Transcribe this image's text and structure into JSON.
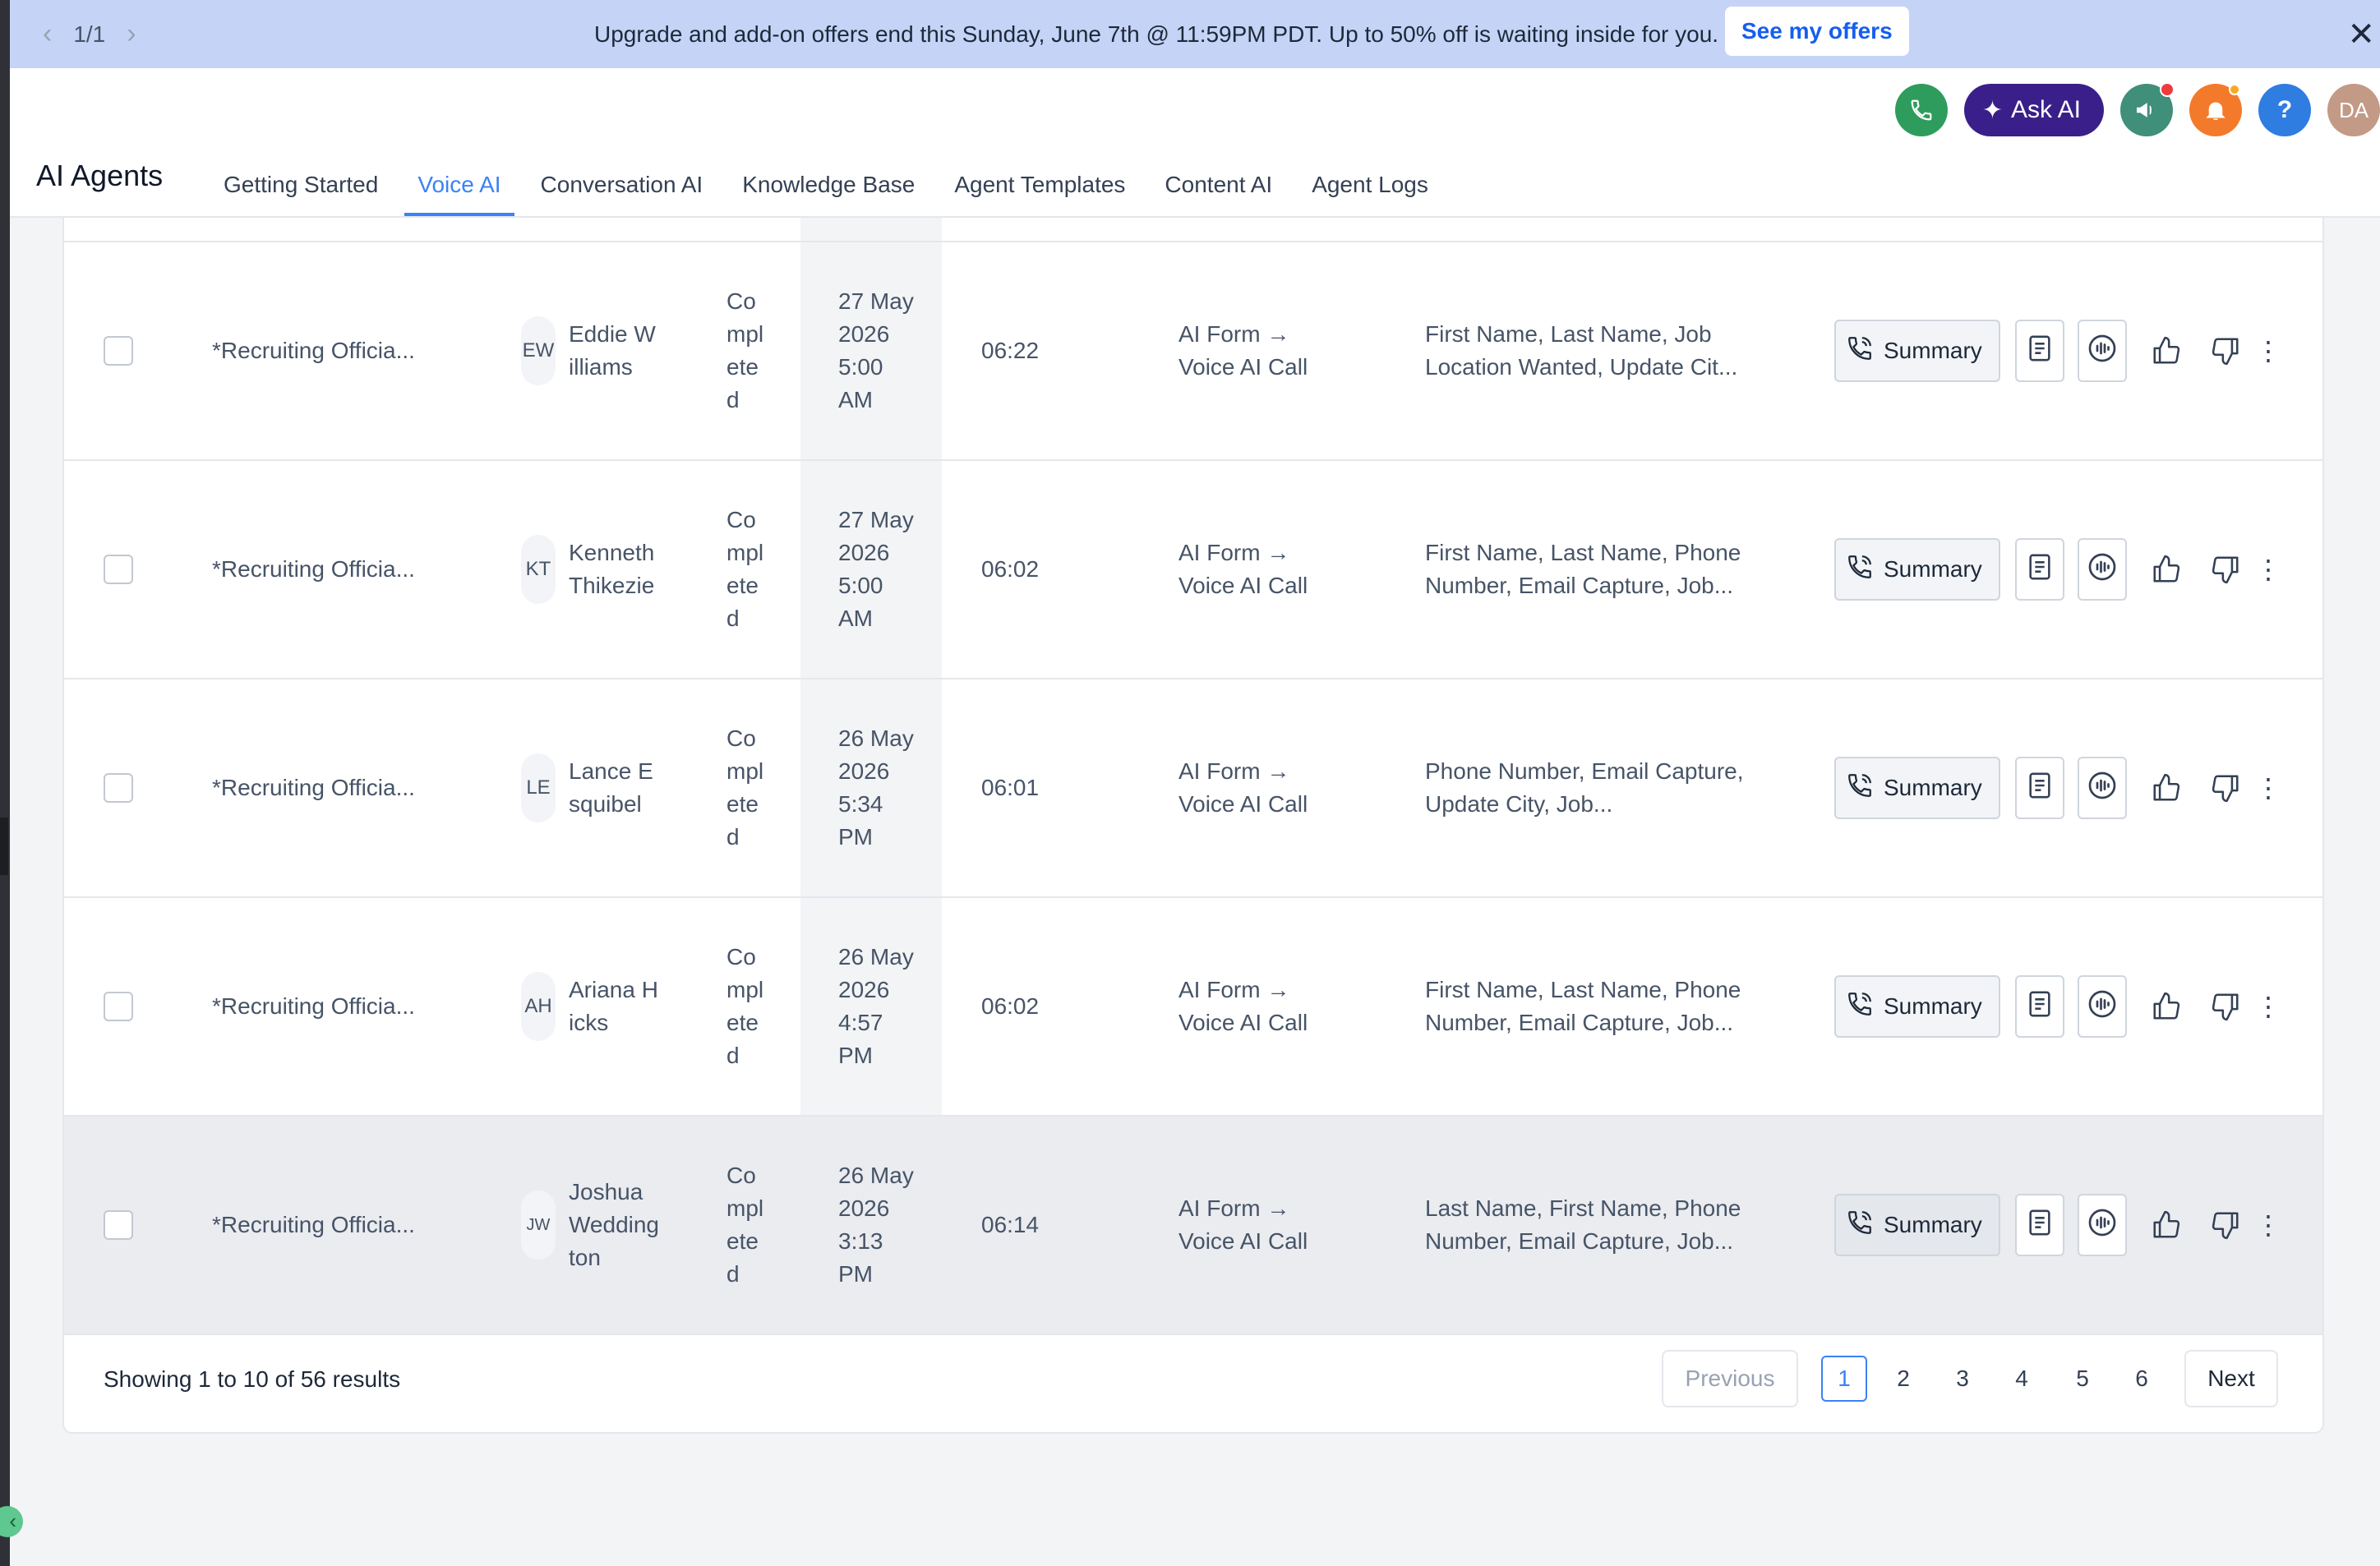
{
  "banner": {
    "pager": "1/1",
    "message": "Upgrade and add-on offers end this Sunday, June 7th @ 11:59PM PDT. Up to 50% off is waiting inside for you.",
    "cta": "See my offers",
    "close": "✕"
  },
  "header": {
    "ask_ai": "Ask AI",
    "help": "?",
    "user_initials": "DA",
    "title": "AI Agents",
    "tabs": [
      {
        "label": "Getting Started"
      },
      {
        "label": "Voice AI"
      },
      {
        "label": "Conversation AI"
      },
      {
        "label": "Knowledge Base"
      },
      {
        "label": "Agent Templates"
      },
      {
        "label": "Content AI"
      },
      {
        "label": "Agent Logs"
      }
    ],
    "active_tab": "Voice AI"
  },
  "rows": [
    {
      "agent": "*Recruiting Officia...",
      "initials": "EW",
      "name": "Eddie Williams",
      "status": "Completed",
      "date": "27 May 2026 5:00 AM",
      "duration": "06:22",
      "action": "AI Form → Voice AI Call",
      "fields": "First Name, Last Name, Job Location Wanted, Update Cit...",
      "summary": "Summary"
    },
    {
      "agent": "*Recruiting Officia...",
      "initials": "KT",
      "name": "Kenneth Thikezie",
      "status": "Completed",
      "date": "27 May 2026 5:00 AM",
      "duration": "06:02",
      "action": "AI Form → Voice AI Call",
      "fields": "First Name, Last Name, Phone Number, Email Capture, Job...",
      "summary": "Summary"
    },
    {
      "agent": "*Recruiting Officia...",
      "initials": "LE",
      "name": "Lance Esquibel",
      "status": "Completed",
      "date": "26 May 2026 5:34 PM",
      "duration": "06:01",
      "action": "AI Form → Voice AI Call",
      "fields": "Phone Number, Email Capture, Update City, Job...",
      "summary": "Summary"
    },
    {
      "agent": "*Recruiting Officia...",
      "initials": "AH",
      "name": "Ariana Hicks",
      "status": "Completed",
      "date": "26 May 2026 4:57 PM",
      "duration": "06:02",
      "action": "AI Form → Voice AI Call",
      "fields": "First Name, Last Name, Phone Number, Email Capture, Job...",
      "summary": "Summary"
    },
    {
      "agent": "*Recruiting Officia...",
      "initials": "JW",
      "name": "Joshua Weddington",
      "status": "Completed",
      "date": "26 May 2026 3:13 PM",
      "duration": "06:14",
      "action": "AI Form → Voice AI Call",
      "fields": "Last Name, First Name, Phone Number, Email Capture, Job...",
      "summary": "Summary"
    }
  ],
  "pagination": {
    "results": "Showing 1 to 10 of 56 results",
    "previous": "Previous",
    "next": "Next",
    "pages": [
      "1",
      "2",
      "3",
      "4",
      "5",
      "6"
    ],
    "current": "1"
  }
}
